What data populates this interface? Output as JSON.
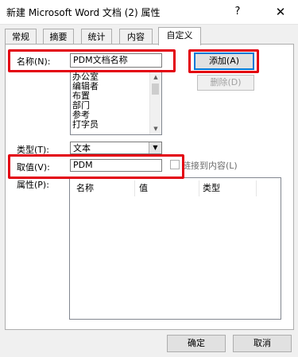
{
  "window": {
    "title": "新建 Microsoft Word 文档 (2) 属性",
    "help_glyph": "?",
    "close_glyph": "✕"
  },
  "tabs": [
    "常规",
    "摘要",
    "统计",
    "内容",
    "自定义"
  ],
  "active_tab": "自定义",
  "form": {
    "name_label": "名称(N):",
    "name_value": "PDM文档名称",
    "name_list": [
      "办公室",
      "编辑者",
      "布置",
      "部门",
      "参考",
      "打字员"
    ],
    "type_label": "类型(T):",
    "type_value": "文本",
    "value_label": "取值(V):",
    "value_value": "PDM",
    "link_label": "链接到内容(L)",
    "props_label": "属性(P):"
  },
  "buttons": {
    "add": "添加(A)",
    "delete": "删除(D)",
    "ok": "确定",
    "cancel": "取消"
  },
  "properties_table": {
    "columns": [
      "名称",
      "值",
      "类型"
    ]
  },
  "colors": {
    "highlight": "#e3000f",
    "focus_border": "#0078d7"
  }
}
